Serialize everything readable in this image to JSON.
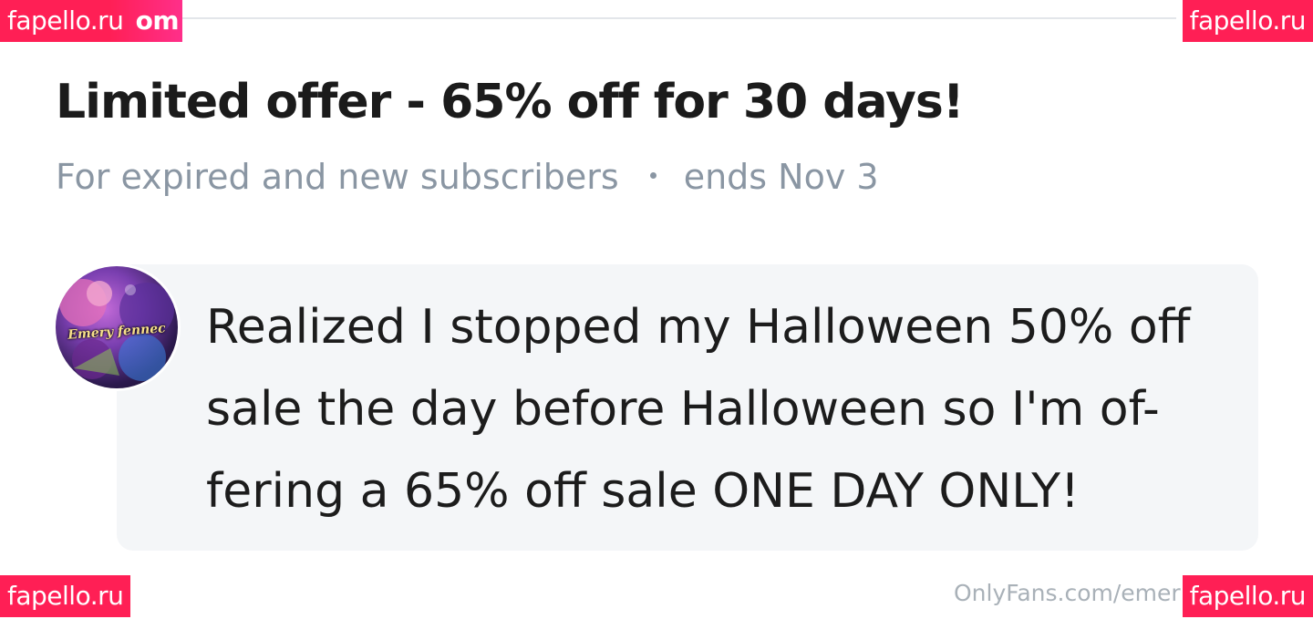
{
  "watermarks": {
    "top_left": "fapello.ru",
    "top_left_tail": "om",
    "top_right": "fapello.ru",
    "bottom_left": "fapello.ru",
    "bottom_right": "fapello.ru"
  },
  "offer": {
    "title": "Limited offer - 65% off for 30 days!",
    "audience": "For expired and new subscribers",
    "ends": "ends Nov 3"
  },
  "message": {
    "avatar_signature": "Emery fennec",
    "text": "Realized I stopped my Halloween 50% off\nsale the day before Halloween so I'm of-\nfering a 65% off sale ONE DAY ONLY!"
  },
  "footer": {
    "source": "OnlyFans.com/emer"
  },
  "colors": {
    "watermark_bg": "#ff1f55",
    "subtitle_gray": "#8a96a3",
    "card_bg": "#f4f6f8"
  }
}
